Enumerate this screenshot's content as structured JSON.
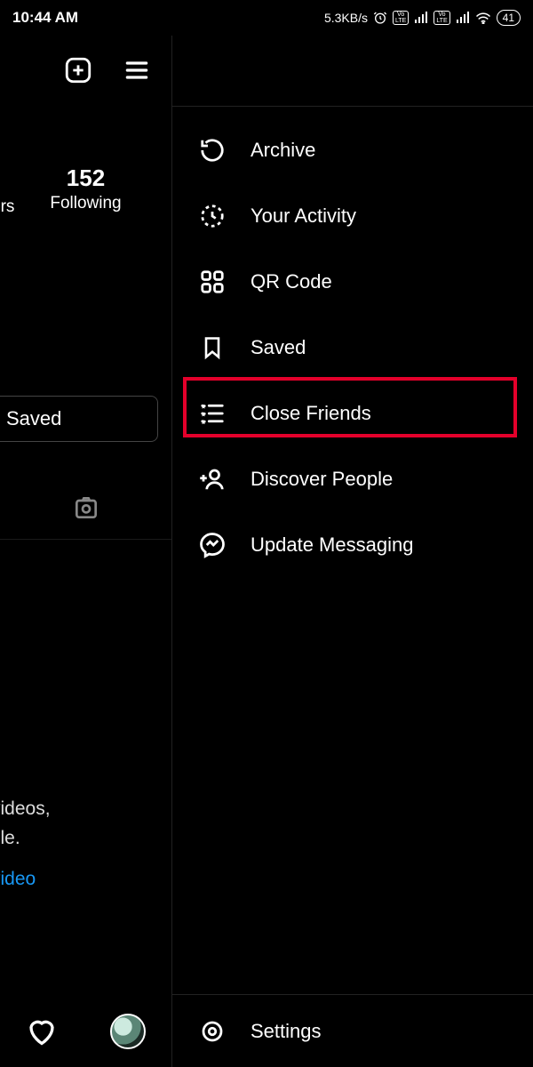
{
  "statusbar": {
    "time": "10:44 AM",
    "net_speed": "5.3KB/s",
    "battery": "41"
  },
  "profile": {
    "following_count": "152",
    "following_label": "Following",
    "ers_fragment": "ers",
    "saved_button": "Saved",
    "hint_line1": "videos,",
    "hint_line2": "file.",
    "hint_link": "video"
  },
  "menu": {
    "items": [
      {
        "label": "Archive"
      },
      {
        "label": "Your Activity"
      },
      {
        "label": "QR Code"
      },
      {
        "label": "Saved"
      },
      {
        "label": "Close Friends"
      },
      {
        "label": "Discover People"
      },
      {
        "label": "Update Messaging"
      }
    ],
    "settings": "Settings"
  }
}
